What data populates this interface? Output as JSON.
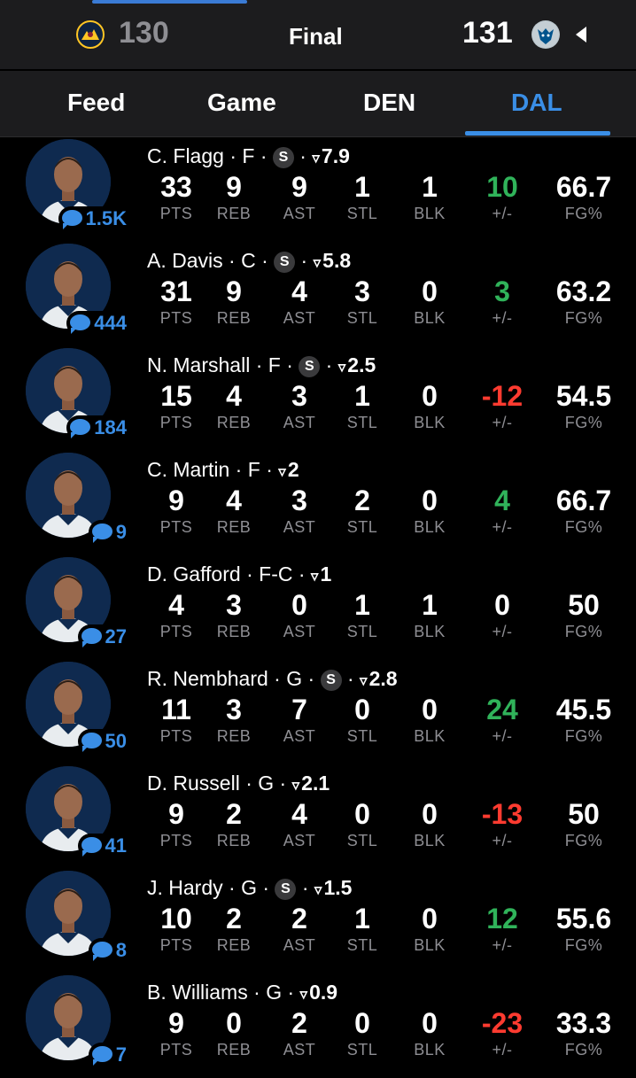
{
  "scoreboard": {
    "away_score": "130",
    "status": "Final",
    "home_score": "131",
    "away_team": "Denver Nuggets",
    "home_team": "Dallas Mavericks"
  },
  "tabs": [
    {
      "label": "Feed",
      "active": false
    },
    {
      "label": "Game",
      "active": false
    },
    {
      "label": "DEN",
      "active": false
    },
    {
      "label": "DAL",
      "active": true
    }
  ],
  "stat_labels": {
    "pts": "PTS",
    "reb": "REB",
    "ast": "AST",
    "stl": "STL",
    "blk": "BLK",
    "pm": "+/-",
    "fg": "FG%"
  },
  "players": [
    {
      "name": "C. Flagg",
      "pos": "F",
      "starter": true,
      "rating": "7.9",
      "comments": "1.5K",
      "pts": "33",
      "reb": "9",
      "ast": "9",
      "stl": "1",
      "blk": "1",
      "pm": "10",
      "pm_sign": "pos",
      "fg": "66.7"
    },
    {
      "name": "A. Davis",
      "pos": "C",
      "starter": true,
      "rating": "5.8",
      "comments": "444",
      "pts": "31",
      "reb": "9",
      "ast": "4",
      "stl": "3",
      "blk": "0",
      "pm": "3",
      "pm_sign": "pos",
      "fg": "63.2"
    },
    {
      "name": "N. Marshall",
      "pos": "F",
      "starter": true,
      "rating": "2.5",
      "comments": "184",
      "pts": "15",
      "reb": "4",
      "ast": "3",
      "stl": "1",
      "blk": "0",
      "pm": "-12",
      "pm_sign": "neg",
      "fg": "54.5"
    },
    {
      "name": "C. Martin",
      "pos": "F",
      "starter": false,
      "rating": "2",
      "comments": "9",
      "pts": "9",
      "reb": "4",
      "ast": "3",
      "stl": "2",
      "blk": "0",
      "pm": "4",
      "pm_sign": "pos",
      "fg": "66.7"
    },
    {
      "name": "D. Gafford",
      "pos": "F-C",
      "starter": false,
      "rating": "1",
      "comments": "27",
      "pts": "4",
      "reb": "3",
      "ast": "0",
      "stl": "1",
      "blk": "1",
      "pm": "0",
      "pm_sign": "neu",
      "fg": "50"
    },
    {
      "name": "R. Nembhard",
      "pos": "G",
      "starter": true,
      "rating": "2.8",
      "comments": "50",
      "pts": "11",
      "reb": "3",
      "ast": "7",
      "stl": "0",
      "blk": "0",
      "pm": "24",
      "pm_sign": "pos",
      "fg": "45.5"
    },
    {
      "name": "D. Russell",
      "pos": "G",
      "starter": false,
      "rating": "2.1",
      "comments": "41",
      "pts": "9",
      "reb": "2",
      "ast": "4",
      "stl": "0",
      "blk": "0",
      "pm": "-13",
      "pm_sign": "neg",
      "fg": "50"
    },
    {
      "name": "J. Hardy",
      "pos": "G",
      "starter": true,
      "rating": "1.5",
      "comments": "8",
      "pts": "10",
      "reb": "2",
      "ast": "2",
      "stl": "1",
      "blk": "0",
      "pm": "12",
      "pm_sign": "pos",
      "fg": "55.6"
    },
    {
      "name": "B. Williams",
      "pos": "G",
      "starter": false,
      "rating": "0.9",
      "comments": "7",
      "pts": "9",
      "reb": "0",
      "ast": "2",
      "stl": "0",
      "blk": "0",
      "pm": "-23",
      "pm_sign": "neg",
      "fg": "33.3"
    }
  ],
  "ui": {
    "starter_badge": "S",
    "separator": " · ",
    "rating_icon": "▿"
  },
  "colors": {
    "accent": "#3a8ee6",
    "positive": "#30b35a",
    "negative": "#ff3b30",
    "muted": "#8e8e93"
  }
}
